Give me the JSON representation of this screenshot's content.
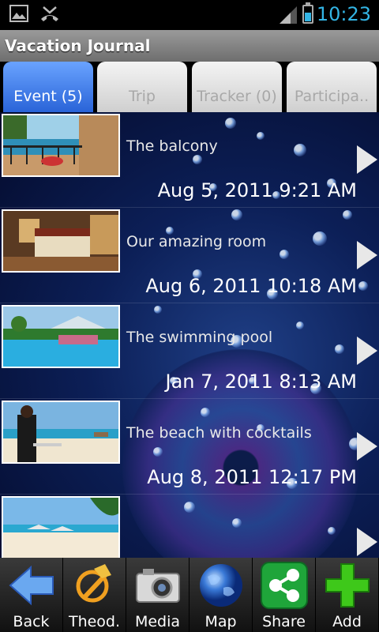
{
  "status_bar": {
    "time": "10:23",
    "icons": [
      "image-icon",
      "missed-call-icon",
      "signal-icon",
      "battery-icon"
    ],
    "battery_level": 0.6
  },
  "app": {
    "title": "Vacation Journal"
  },
  "tabs": [
    {
      "label": "Event (5)",
      "active": true
    },
    {
      "label": "Trip",
      "active": false
    },
    {
      "label": "Tracker (0)",
      "active": false
    },
    {
      "label": "Participa..",
      "active": false
    }
  ],
  "events": [
    {
      "title": "The balcony",
      "date": "Aug 5, 2011 9:21 AM"
    },
    {
      "title": "Our amazing room",
      "date": "Aug 6, 2011 10:18 AM"
    },
    {
      "title": "The swimming pool",
      "date": "Jan 7, 2011 8:13 AM"
    },
    {
      "title": "The beach with cocktails",
      "date": "Aug 8, 2011 12:17 PM"
    },
    {
      "title": "",
      "date": ""
    }
  ],
  "toolbar": [
    {
      "label": "Back",
      "icon": "back-arrow-icon"
    },
    {
      "label": "Theod.",
      "icon": "theodolite-icon"
    },
    {
      "label": "Media",
      "icon": "camera-icon"
    },
    {
      "label": "Map",
      "icon": "globe-icon"
    },
    {
      "label": "Share",
      "icon": "share-icon"
    },
    {
      "label": "Add",
      "icon": "plus-icon"
    }
  ],
  "colors": {
    "accent": "#33b5e5",
    "active_tab": "#2a64d8",
    "background": "#0c1f57",
    "share_green": "#1fa53a",
    "add_green": "#3ec81a"
  }
}
